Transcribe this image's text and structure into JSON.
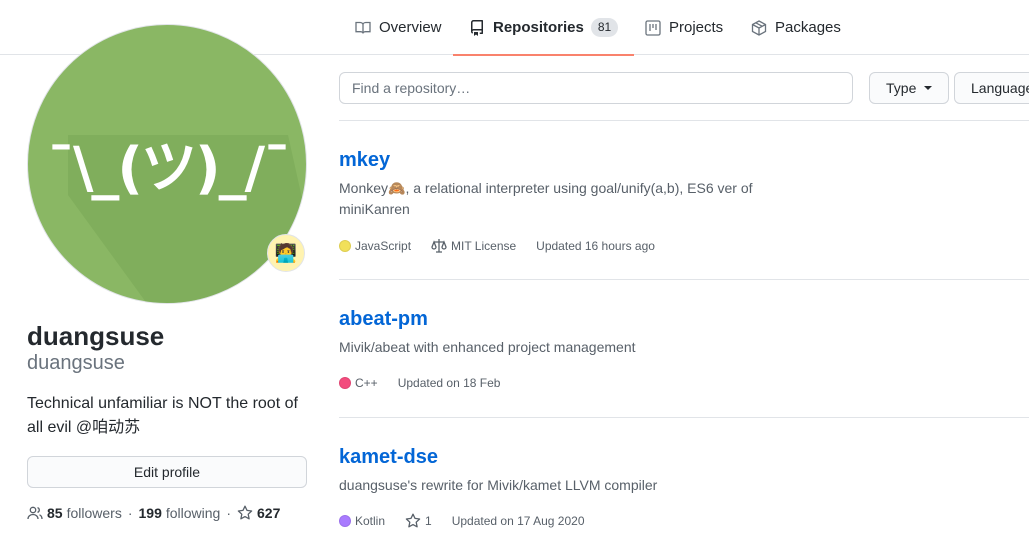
{
  "nav": {
    "tabs": [
      {
        "label": "Overview",
        "icon": "book-icon"
      },
      {
        "label": "Repositories",
        "icon": "repo-icon",
        "count": "81",
        "selected": true
      },
      {
        "label": "Projects",
        "icon": "project-icon"
      },
      {
        "label": "Packages",
        "icon": "package-icon"
      }
    ],
    "accent_color": "#f9826c"
  },
  "profile": {
    "avatar_text": "¯\\_(ツ)_/¯",
    "avatar_color": "#8ab764",
    "status_emoji": "🧑‍💻",
    "name": "duangsuse",
    "login": "duangsuse",
    "bio": "Technical unfamiliar is NOT the root of all evil @咱动苏",
    "edit_label": "Edit profile",
    "followers_count": "85",
    "followers_label": "followers",
    "following_count": "199",
    "following_label": "following",
    "stars_count": "627"
  },
  "filters": {
    "search_placeholder": "Find a repository…",
    "type_label": "Type",
    "language_label": "Language"
  },
  "repos": [
    {
      "name": "mkey",
      "description": "Monkey🙈, a relational interpreter using goal/unify(a,b), ES6 ver of miniKanren",
      "language": "JavaScript",
      "language_color": "#f1e05a",
      "license": "MIT License",
      "updated": "Updated 16 hours ago"
    },
    {
      "name": "abeat-pm",
      "description": "Mivik/abeat with enhanced project management",
      "language": "C++",
      "language_color": "#f34b7d",
      "updated": "Updated on 18 Feb"
    },
    {
      "name": "kamet-dse",
      "description": "duangsuse's rewrite for Mivik/kamet LLVM compiler",
      "language": "Kotlin",
      "language_color": "#a97bff",
      "stars": "1",
      "updated": "Updated on 17 Aug 2020"
    }
  ]
}
